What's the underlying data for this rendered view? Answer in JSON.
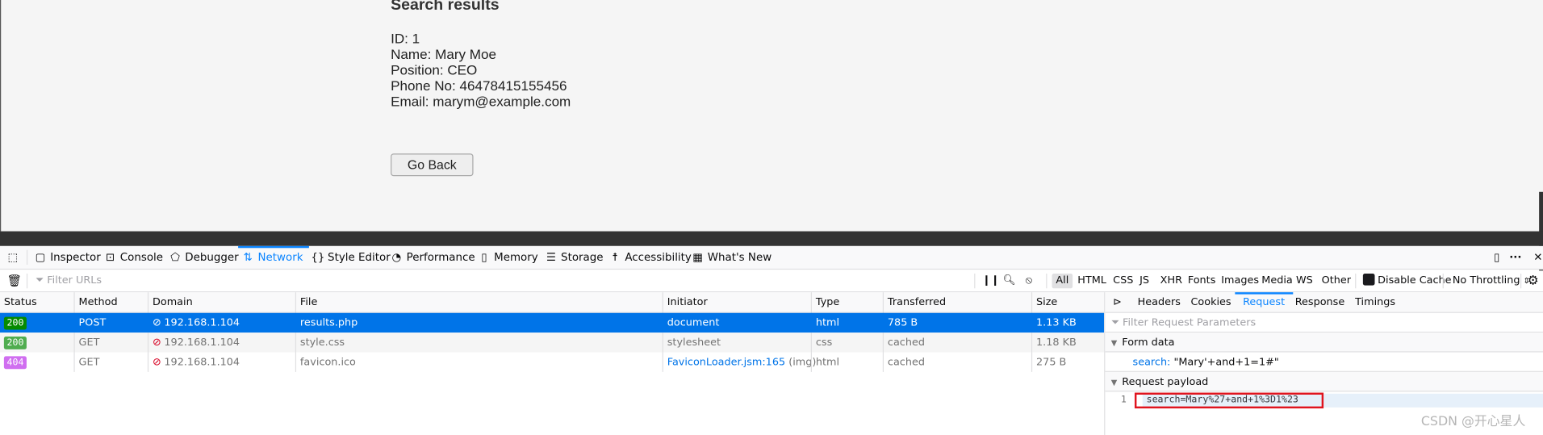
{
  "page": {
    "heading": "Search results",
    "lines": [
      "ID: 1",
      "Name: Mary Moe",
      "Position: CEO",
      "Phone No: 46478415155456",
      "Email: marym@example.com"
    ],
    "go_back": "Go Back"
  },
  "devtools": {
    "tabs": [
      {
        "label": "Inspector",
        "icon": "inspector-icon"
      },
      {
        "label": "Console",
        "icon": "console-icon"
      },
      {
        "label": "Debugger",
        "icon": "debugger-icon"
      },
      {
        "label": "Network",
        "icon": "network-icon",
        "selected": true
      },
      {
        "label": "Style Editor",
        "icon": "braces-icon"
      },
      {
        "label": "Performance",
        "icon": "gauge-icon"
      },
      {
        "label": "Memory",
        "icon": "chip-icon"
      },
      {
        "label": "Storage",
        "icon": "storage-icon"
      },
      {
        "label": "Accessibility",
        "icon": "accessibility-icon"
      },
      {
        "label": "What's New",
        "icon": "gift-icon"
      }
    ],
    "filter_placeholder": "Filter URLs",
    "type_filters": [
      "All",
      "HTML",
      "CSS",
      "JS",
      "XHR",
      "Fonts",
      "Images",
      "Media",
      "WS",
      "Other"
    ],
    "active_filter": "All",
    "disable_cache": "Disable Cache",
    "throttling": "No Throttling",
    "columns": [
      "Status",
      "Method",
      "Domain",
      "File",
      "Initiator",
      "Type",
      "Transferred",
      "Size"
    ],
    "requests": [
      {
        "status": "200",
        "status_color": "#058b00",
        "method": "POST",
        "domain": "192.168.1.104",
        "file": "results.php",
        "initiator": "document",
        "initiator_extra": "",
        "type": "html",
        "transferred": "785 B",
        "size": "1.13 KB"
      },
      {
        "status": "200",
        "status_color": "#4fad4f",
        "method": "GET",
        "domain": "192.168.1.104",
        "file": "style.css",
        "initiator": "stylesheet",
        "initiator_extra": "",
        "type": "css",
        "transferred": "cached",
        "size": "1.18 KB"
      },
      {
        "status": "404",
        "status_color": "#d06ef0",
        "method": "GET",
        "domain": "192.168.1.104",
        "file": "favicon.ico",
        "initiator": "FaviconLoader.jsm:165",
        "initiator_extra": "(img)",
        "type": "html",
        "transferred": "cached",
        "size": "275 B"
      }
    ],
    "panel": {
      "tabs": [
        "Headers",
        "Cookies",
        "Request",
        "Response",
        "Timings"
      ],
      "selected_tab": "Request",
      "filter_placeholder": "Filter Request Parameters",
      "form_data_title": "Form data",
      "form_key": "search:",
      "form_value": "\"Mary'+and+1=1#\"",
      "payload_title": "Request payload",
      "payload_line_number": "1",
      "payload": "search=Mary%27+and+1%3D1%23"
    },
    "accent": "#0074e8"
  },
  "watermark": "CSDN @开心星人"
}
